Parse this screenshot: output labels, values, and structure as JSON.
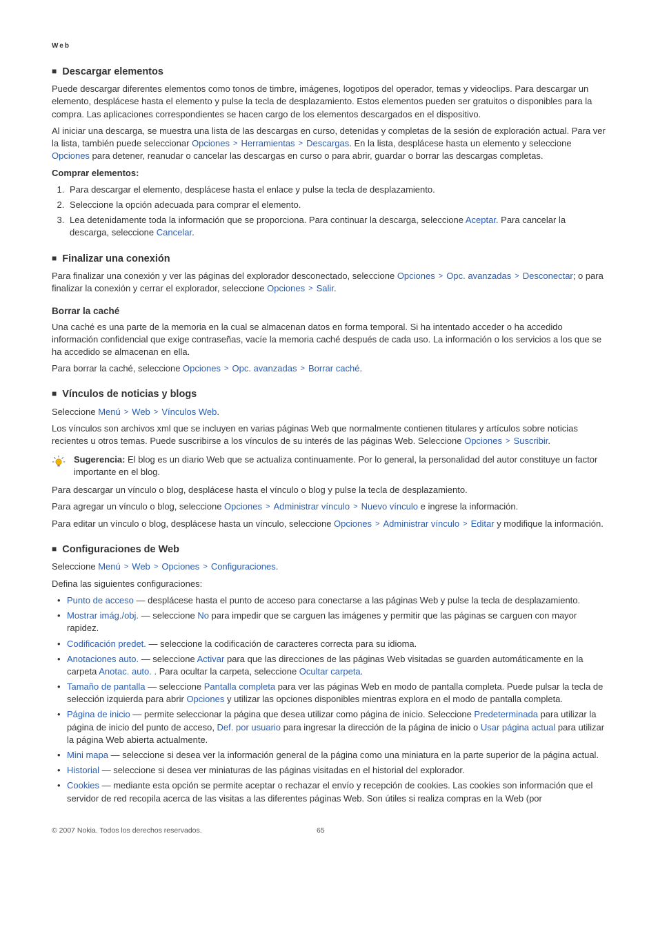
{
  "header": "Web",
  "s1": {
    "title": "Descargar elementos",
    "p1": "Puede descargar diferentes elementos como tonos de timbre, imágenes, logotipos del operador, temas y videoclips. Para descargar un elemento, desplácese hasta el elemento y pulse la tecla de desplazamiento. Estos elementos pueden ser gratuitos o disponibles para la compra. Las aplicaciones correspondientes se hacen cargo de los elementos descargados en el dispositivo.",
    "p2a": "Al iniciar una descarga, se muestra una lista de las descargas en curso, detenidas y completas de la sesión de exploración actual. Para ver la lista, también puede seleccionar ",
    "p2_opc": "Opciones",
    "p2_herr": "Herramientas",
    "p2_desc": "Descargas",
    "p2b": ". En la lista, desplácese hasta un elemento y seleccione ",
    "p2_opc2": "Opciones",
    "p2c": " para detener, reanudar o cancelar las descargas en curso o para abrir, guardar o borrar las descargas completas.",
    "buy_title": "Comprar elementos:",
    "li1": "Para descargar el elemento, desplácese hasta el enlace y pulse la tecla de desplazamiento.",
    "li2": "Seleccione la opción adecuada para comprar el elemento.",
    "li3a": "Lea detenidamente toda la información que se proporciona. Para continuar la descarga, seleccione ",
    "li3_accept": "Aceptar",
    "li3b": ". Para cancelar la descarga, seleccione ",
    "li3_cancel": "Cancelar",
    "li3c": "."
  },
  "s2": {
    "title": "Finalizar una conexión",
    "p1a": "Para finalizar una conexión y ver las páginas del explorador desconectado, seleccione ",
    "opc": "Opciones",
    "opc_av": "Opc. avanzadas",
    "desc": "Desconectar",
    "p1b": "; o para finalizar la conexión y cerrar el explorador, seleccione ",
    "opc2": "Opciones",
    "salir": "Salir",
    "p1c": ".",
    "sub": "Borrar la caché",
    "sp1": "Una caché es una parte de la memoria en la cual se almacenan datos en forma temporal. Si ha intentado acceder o ha accedido información confidencial que exige contraseñas, vacíe la memoria caché después de cada uso. La información o los servicios a los que se ha accedido se almacenan en ella.",
    "sp2a": "Para borrar la caché, seleccione ",
    "sp2_opc": "Opciones",
    "sp2_opcav": "Opc. avanzadas",
    "sp2_borrar": "Borrar caché",
    "sp2b": "."
  },
  "s3": {
    "title": "Vínculos de noticias y blogs",
    "p1a": "Seleccione ",
    "menu": "Menú",
    "web": "Web",
    "vinc": "Vínculos Web",
    "p1b": ".",
    "p2a": "Los vínculos son archivos xml que se incluyen en varias páginas Web que normalmente contienen titulares y artículos sobre noticias recientes u otros temas. Puede suscribirse a los vínculos de su interés de las páginas Web. Seleccione ",
    "opc": "Opciones",
    "sus": "Suscribir",
    "p2b": ".",
    "tip_label": "Sugerencia: ",
    "tip_text": "El blog es un diario Web que se actualiza continuamente. Por lo general, la personalidad del autor constituye un factor importante en el blog.",
    "p3": "Para descargar un vínculo o blog, desplácese hasta el vínculo o blog y pulse la tecla de desplazamiento.",
    "p4a": "Para agregar un vínculo o blog, seleccione ",
    "p4_opc": "Opciones",
    "p4_adm": "Administrar vínculo",
    "p4_nuevo": "Nuevo vínculo",
    "p4b": " e ingrese la información.",
    "p5a": "Para editar un vínculo o blog, desplácese hasta un vínculo, seleccione ",
    "p5_opc": "Opciones",
    "p5_adm": "Administrar vínculo",
    "p5_edit": "Editar",
    "p5b": " y modifique la información."
  },
  "s4": {
    "title": "Configuraciones de Web",
    "p1a": "Seleccione ",
    "menu": "Menú",
    "web": "Web",
    "opc": "Opciones",
    "conf": "Configuraciones",
    "p1b": ".",
    "p2": "Defina las siguientes configuraciones:",
    "items": {
      "i1": {
        "k": "Punto de acceso",
        "t": " — desplácese hasta el punto de acceso para conectarse a las páginas Web y pulse la tecla de desplazamiento."
      },
      "i2": {
        "k": "Mostrar imág./obj.",
        "t1": " — seleccione ",
        "no": "No",
        "t2": " para impedir que se carguen las imágenes y permitir que las páginas se carguen con mayor rapidez."
      },
      "i3": {
        "k": "Codificación predet.",
        "t": " — seleccione la codificación de caracteres correcta para su idioma."
      },
      "i4": {
        "k": "Anotaciones auto.",
        "t1": " — seleccione ",
        "act": "Activar",
        "t2": " para que las direcciones de las páginas Web visitadas se guarden automáticamente en la carpeta ",
        "anot": "Anotac. auto.",
        "t3": " . Para ocultar la carpeta, seleccione ",
        "oc": "Ocultar carpeta",
        "t4": "."
      },
      "i5": {
        "k": "Tamaño de pantalla",
        "t1": " — seleccione ",
        "pc": "Pantalla completa",
        "t2": " para ver las páginas Web en modo de pantalla completa. Puede pulsar la tecla de selección izquierda para abrir ",
        "opc": "Opciones",
        "t3": " y utilizar las opciones disponibles mientras explora en el modo de pantalla completa."
      },
      "i6": {
        "k": "Página de inicio",
        "t1": " — permite seleccionar la página que desea utilizar como página de inicio. Seleccione ",
        "pre": "Predeterminada",
        "t2": " para utilizar la página de inicio del punto de acceso, ",
        "def": "Def. por usuario",
        "t3": " para ingresar la dirección de la página de inicio o ",
        "usar": "Usar página actual",
        "t4": " para utilizar la página Web abierta actualmente."
      },
      "i7": {
        "k": "Mini mapa",
        "t": " — seleccione si desea ver la información general de la página como una miniatura en la parte superior de la página actual."
      },
      "i8": {
        "k": "Historial",
        "t": " — seleccione si desea ver miniaturas de las páginas visitadas en el historial del explorador."
      },
      "i9": {
        "k": "Cookies",
        "t": " — mediante esta opción se permite aceptar o rechazar el envío y recepción de cookies. Las cookies son información que el servidor de red recopila acerca de las visitas a las diferentes páginas Web. Son útiles si realiza compras en la Web (por"
      }
    }
  },
  "footer": {
    "copyright": "© 2007 Nokia. Todos los derechos reservados.",
    "page": "65"
  }
}
